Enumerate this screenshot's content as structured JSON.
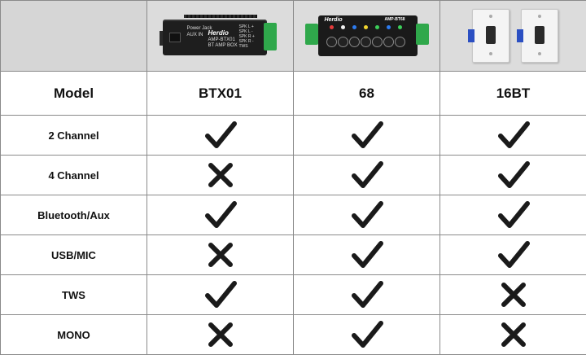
{
  "header": {
    "products": [
      {
        "image": "btx01-amp-box",
        "jack_label": "Power Jack",
        "aux_label": "AUX IN",
        "brand": "Herdio",
        "model_text": "AMP-BTX01",
        "box_text": "BT AMP BOX",
        "spk_labels": [
          "SPK L +",
          "SPK L -",
          "SPK R +",
          "SPK R -"
        ],
        "tws_label": "TWS"
      },
      {
        "image": "68-amp-panel",
        "brand": "Herdio",
        "model_text": "AMP-BT68"
      },
      {
        "image": "16bt-wall-plates"
      }
    ]
  },
  "model_row": {
    "label": "Model",
    "values": [
      "BTX01",
      "68",
      "16BT"
    ]
  },
  "features": [
    {
      "label": "2 Channel",
      "values": [
        "check",
        "check",
        "check"
      ]
    },
    {
      "label": "4 Channel",
      "values": [
        "cross",
        "check",
        "check"
      ]
    },
    {
      "label": "Bluetooth/Aux",
      "values": [
        "check",
        "check",
        "check"
      ]
    },
    {
      "label": "USB/MIC",
      "values": [
        "cross",
        "check",
        "check"
      ]
    },
    {
      "label": "TWS",
      "values": [
        "check",
        "check",
        "cross"
      ]
    },
    {
      "label": "MONO",
      "values": [
        "cross",
        "check",
        "cross"
      ]
    }
  ],
  "colors": {
    "header_bg": "#dcdcdc",
    "border": "#8a8a8a",
    "mark": "#1a1a1a",
    "terminal_green": "#2fa84b"
  }
}
